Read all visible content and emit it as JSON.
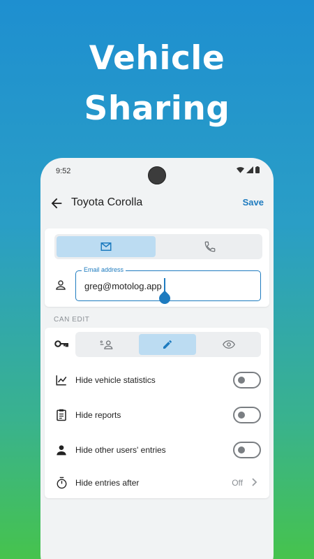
{
  "headline": [
    "Vehicle",
    "Sharing"
  ],
  "status": {
    "time": "9:52"
  },
  "appbar": {
    "title": "Toyota Corolla",
    "save_label": "Save"
  },
  "contact": {
    "tabs": [
      {
        "icon": "mail-icon",
        "selected": true
      },
      {
        "icon": "phone-icon",
        "selected": false
      }
    ],
    "email_label": "Email address",
    "email_value": "greg@motolog.app"
  },
  "section_label": "CAN EDIT",
  "permission": {
    "options": [
      {
        "icon": "person-remove-icon",
        "selected": false
      },
      {
        "icon": "pencil-icon",
        "selected": true
      },
      {
        "icon": "eye-icon",
        "selected": false
      }
    ]
  },
  "settings": [
    {
      "icon": "chart-icon",
      "label": "Hide vehicle statistics",
      "type": "toggle",
      "on": false
    },
    {
      "icon": "clipboard-icon",
      "label": "Hide reports",
      "type": "toggle",
      "on": false
    },
    {
      "icon": "person-icon",
      "label": "Hide other users' entries",
      "type": "toggle",
      "on": false
    },
    {
      "icon": "timer-icon",
      "label": "Hide entries after",
      "type": "value",
      "value": "Off"
    }
  ],
  "colors": {
    "accent": "#1e7bbf",
    "selected_bg": "#bcdcf2"
  }
}
